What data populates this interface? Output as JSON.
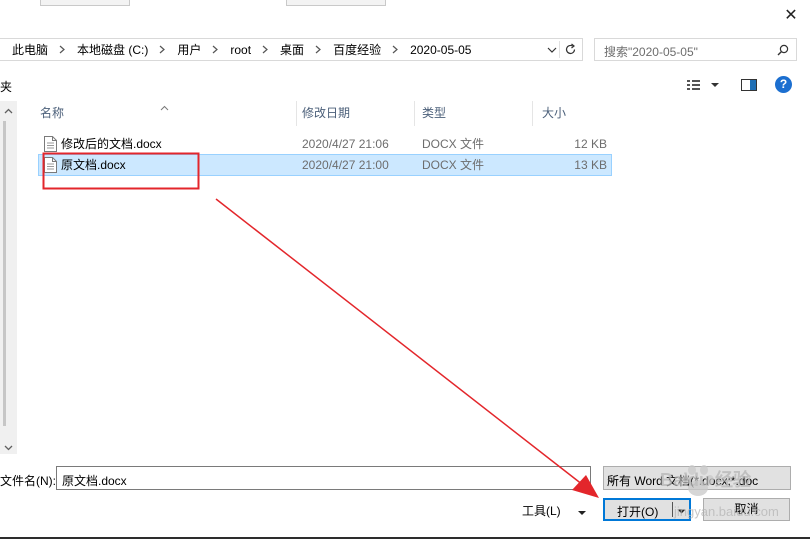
{
  "window": {
    "close_glyph": "✕"
  },
  "address_bar": {
    "breadcrumbs": [
      "此电脑",
      "本地磁盘 (C:)",
      "用户",
      "root",
      "桌面",
      "百度经验",
      "2020-05-05"
    ],
    "dropdown_icon": "chevron-down-icon",
    "refresh_icon": "refresh-icon"
  },
  "search": {
    "placeholder": "搜索\"2020-05-05\"",
    "icon": "search-icon"
  },
  "toolbar": {
    "left_partial_text": "夹",
    "help_label": "?"
  },
  "file_list": {
    "columns": [
      "名称",
      "修改日期",
      "类型",
      "大小"
    ],
    "sort_column": "名称",
    "rows": [
      {
        "name": "修改后的文档.docx",
        "date": "2020/4/27 21:06",
        "type": "DOCX 文件",
        "size": "12 KB",
        "selected": false
      },
      {
        "name": "原文档.docx",
        "date": "2020/4/27 21:00",
        "type": "DOCX 文件",
        "size": "13 KB",
        "selected": true
      }
    ]
  },
  "footer": {
    "filename_label": "文件名(N):",
    "filename_value": "原文档.docx",
    "filter_value": "所有 Word 文档(*.docx;*.doc",
    "tools_label": "工具(L)",
    "open_label": "打开(O)",
    "cancel_label": "取消"
  },
  "annotations": {
    "highlight_color": "#e3262b",
    "arrow_color": "#e3262b"
  },
  "watermark": {
    "text": "Baidu 经验",
    "subtext": "jingyan.baidu.com"
  }
}
